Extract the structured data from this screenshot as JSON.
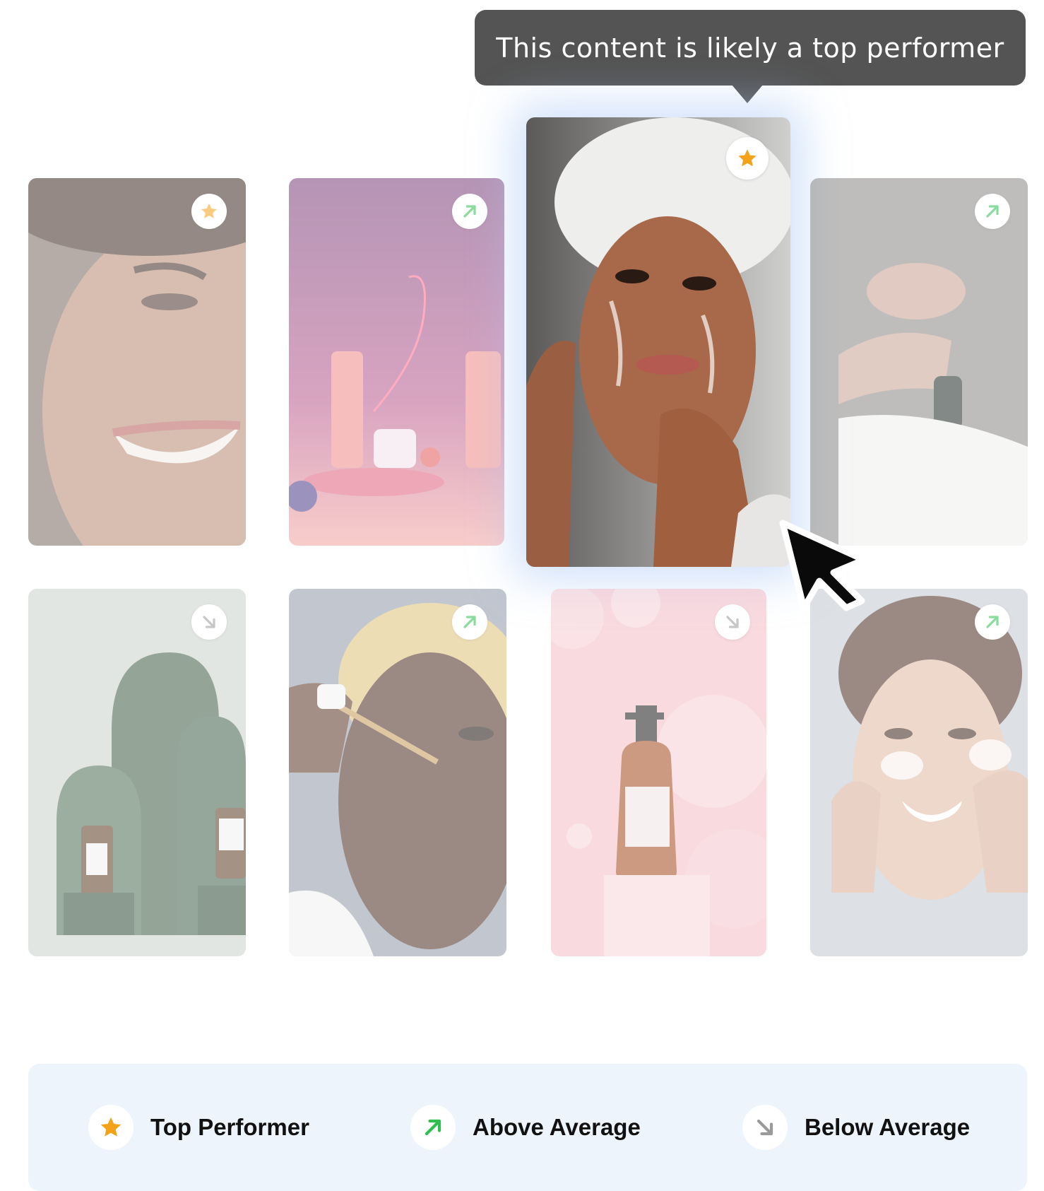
{
  "tooltip": {
    "text": "This content is likely a top performer"
  },
  "colors": {
    "star": "#f5a21b",
    "arrow_up": "#2fbf4f",
    "arrow_down": "#9a9a9a",
    "tooltip_bg": "#545454",
    "legend_bg": "#eef4fc"
  },
  "cards": [
    {
      "id": "card-1",
      "rating": "top-performer",
      "icon": "star-icon",
      "subject": "smiling-woman-curly-hair"
    },
    {
      "id": "card-2",
      "rating": "above-average",
      "icon": "arrow-up-right-icon",
      "subject": "pink-pump-bottles"
    },
    {
      "id": "card-3",
      "rating": "top-performer",
      "icon": "star-icon",
      "subject": "woman-towel-face-wash",
      "featured": true
    },
    {
      "id": "card-4",
      "rating": "above-average",
      "icon": "arrow-up-right-icon",
      "subject": "hands-dropper-bottle"
    },
    {
      "id": "card-5",
      "rating": "below-average",
      "icon": "arrow-down-right-icon",
      "subject": "green-arches-serum-bottles"
    },
    {
      "id": "card-6",
      "rating": "above-average",
      "icon": "arrow-up-right-icon",
      "subject": "man-applying-serum"
    },
    {
      "id": "card-7",
      "rating": "below-average",
      "icon": "arrow-down-right-icon",
      "subject": "amber-pump-bottle-pink"
    },
    {
      "id": "card-8",
      "rating": "above-average",
      "icon": "arrow-up-right-icon",
      "subject": "woman-face-cream"
    }
  ],
  "legend": {
    "items": [
      {
        "label": "Top Performer",
        "icon": "star-icon"
      },
      {
        "label": "Above Average",
        "icon": "arrow-up-right-icon"
      },
      {
        "label": "Below Average",
        "icon": "arrow-down-right-icon"
      }
    ]
  }
}
